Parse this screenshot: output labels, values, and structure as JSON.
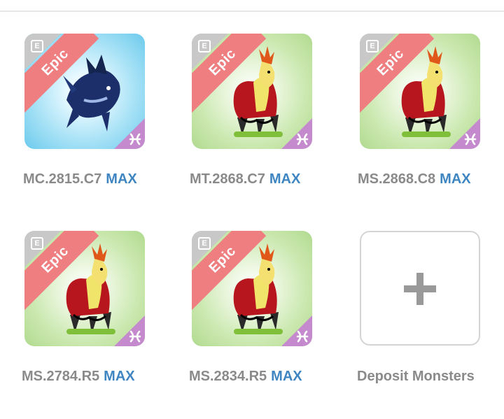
{
  "monsters": [
    {
      "id": "MC.2815.C7",
      "rarity": "Epic",
      "max": "MAX",
      "tier_icon": "E",
      "theme": "blue",
      "creature": "dragon"
    },
    {
      "id": "MT.2868.C7",
      "rarity": "Epic",
      "max": "MAX",
      "tier_icon": "E",
      "theme": "green",
      "creature": "beast"
    },
    {
      "id": "MS.2868.C8",
      "rarity": "Epic",
      "max": "MAX",
      "tier_icon": "E",
      "theme": "green",
      "creature": "beast"
    },
    {
      "id": "MS.2784.R5",
      "rarity": "Epic",
      "max": "MAX",
      "tier_icon": "E",
      "theme": "green",
      "creature": "beast"
    },
    {
      "id": "MS.2834.R5",
      "rarity": "Epic",
      "max": "MAX",
      "tier_icon": "E",
      "theme": "green",
      "creature": "beast"
    }
  ],
  "deposit": {
    "label": "Deposit Monsters",
    "icon": "plus-icon"
  },
  "colors": {
    "rarity_ribbon": "#ef7e80",
    "max_text": "#3f85c2",
    "label_text": "#8a8a8a",
    "element_corner": "#c48acd"
  }
}
